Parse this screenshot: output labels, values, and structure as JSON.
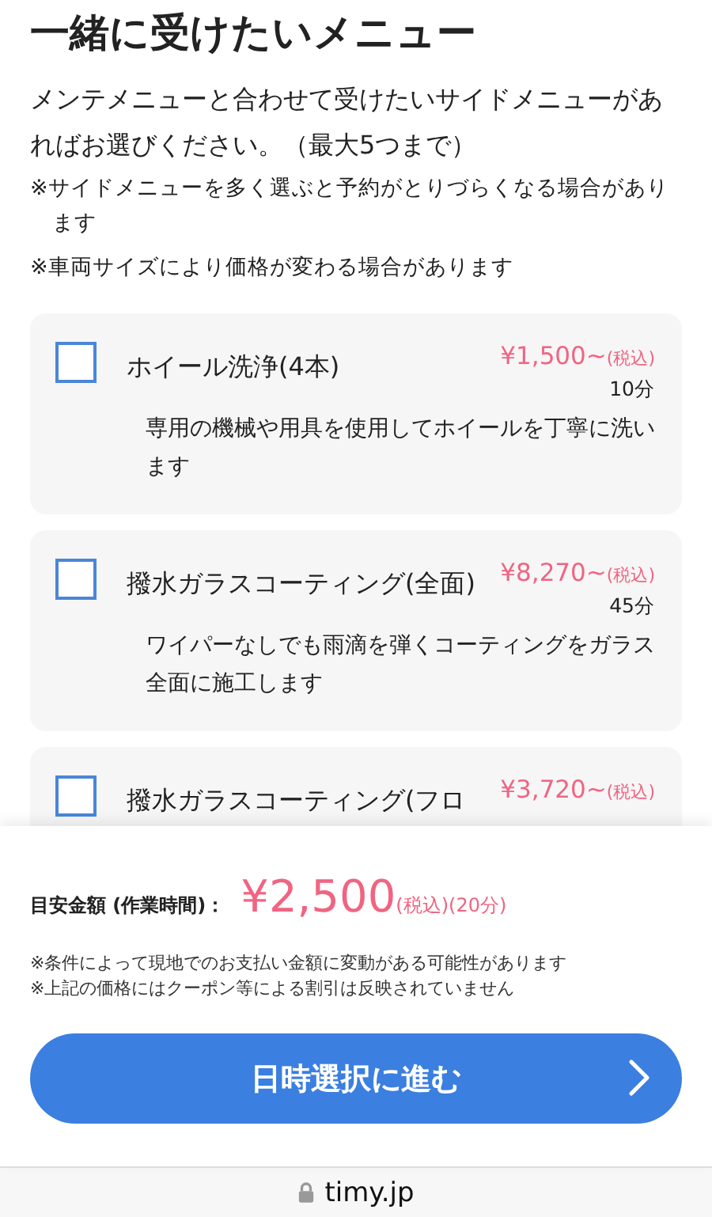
{
  "heading": "一緒に受けたいメニュー",
  "intro": "メンテメニューと合わせて受けたいサイドメニューがあればお選びください。（最大5つまで）",
  "notes": [
    "※サイドメニューを多く選ぶと予約がとりづらくなる場合があります",
    "※車両サイズにより価格が変わる場合があります"
  ],
  "menu_items": [
    {
      "name": "ホイール洗浄(4本)",
      "price": "¥1,500~",
      "tax": "(税込)",
      "duration": "10分",
      "description": "専用の機械や用具を使用してホイールを丁寧に洗います",
      "checked": false
    },
    {
      "name": "撥水ガラスコーティング(全面)",
      "price": "¥8,270~",
      "tax": "(税込)",
      "duration": "45分",
      "description": "ワイパーなしでも雨滴を弾くコーティングをガラス全面に施工します",
      "checked": false
    },
    {
      "name": "撥水ガラスコーティング(フロ",
      "price": "¥3,720~",
      "tax": "(税込)",
      "checked": false
    }
  ],
  "summary": {
    "label": "目安金額 (作業時間)：",
    "amount": "¥2,500",
    "tax": "(税込)",
    "duration": "(20分)",
    "notes": [
      "※条件によって現地でのお支払い金額に変動がある可能性があります",
      "※上記の価格にはクーポン等による割引は反映されていません"
    ],
    "button": "日時選択に進む"
  },
  "address_bar": {
    "url": "timy.jp"
  }
}
